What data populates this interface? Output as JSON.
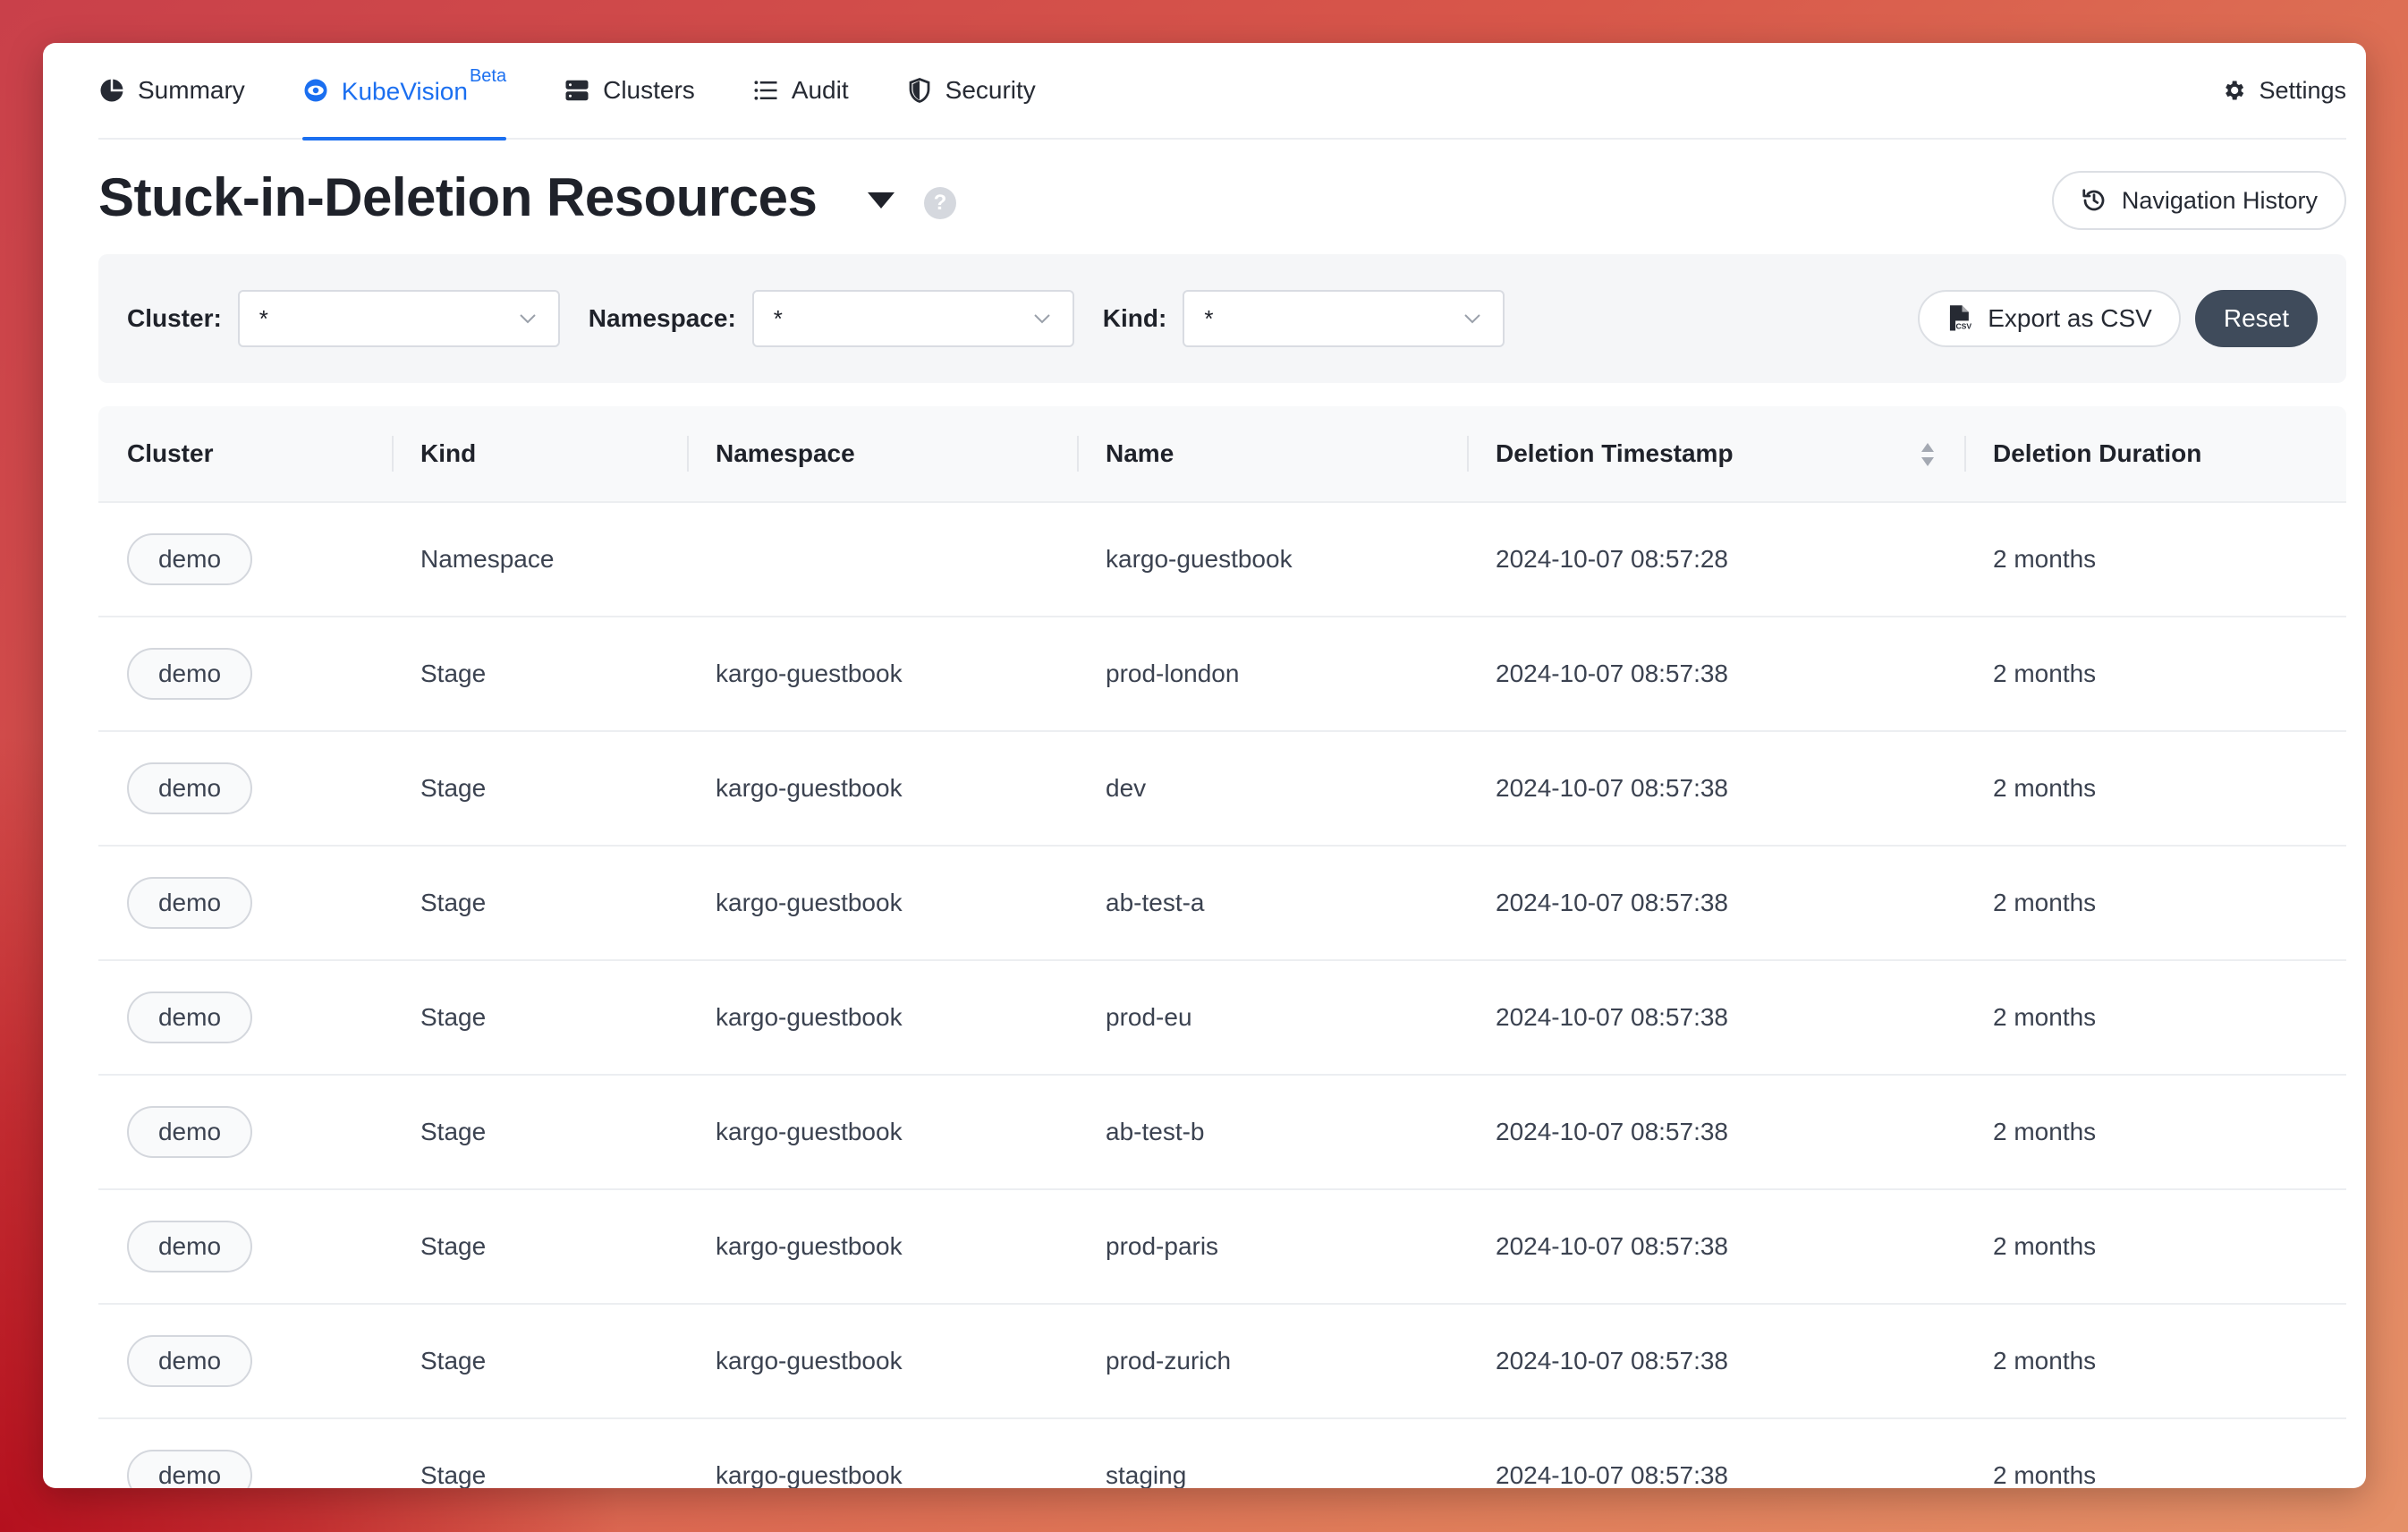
{
  "nav": {
    "tabs": [
      {
        "label": "Summary",
        "icon": "pie-chart-icon"
      },
      {
        "label": "KubeVision",
        "badge": "Beta",
        "icon": "eye-icon",
        "active": true
      },
      {
        "label": "Clusters",
        "icon": "server-icon"
      },
      {
        "label": "Audit",
        "icon": "list-icon"
      },
      {
        "label": "Security",
        "icon": "shield-icon"
      }
    ],
    "settings_label": "Settings",
    "accent_color": "#1b6ff0"
  },
  "header": {
    "title": "Stuck-in-Deletion Resources",
    "help": "?",
    "nav_history_label": "Navigation History"
  },
  "filters": {
    "cluster_label": "Cluster:",
    "cluster_value": "*",
    "namespace_label": "Namespace:",
    "namespace_value": "*",
    "kind_label": "Kind:",
    "kind_value": "*",
    "export_label": "Export as CSV",
    "reset_label": "Reset"
  },
  "table": {
    "columns": [
      "Cluster",
      "Kind",
      "Namespace",
      "Name",
      "Deletion Timestamp",
      "Deletion Duration"
    ],
    "rows": [
      {
        "cluster": "demo",
        "kind": "Namespace",
        "namespace": "",
        "name": "kargo-guestbook",
        "timestamp": "2024-10-07 08:57:28",
        "duration": "2 months"
      },
      {
        "cluster": "demo",
        "kind": "Stage",
        "namespace": "kargo-guestbook",
        "name": "prod-london",
        "timestamp": "2024-10-07 08:57:38",
        "duration": "2 months"
      },
      {
        "cluster": "demo",
        "kind": "Stage",
        "namespace": "kargo-guestbook",
        "name": "dev",
        "timestamp": "2024-10-07 08:57:38",
        "duration": "2 months"
      },
      {
        "cluster": "demo",
        "kind": "Stage",
        "namespace": "kargo-guestbook",
        "name": "ab-test-a",
        "timestamp": "2024-10-07 08:57:38",
        "duration": "2 months"
      },
      {
        "cluster": "demo",
        "kind": "Stage",
        "namespace": "kargo-guestbook",
        "name": "prod-eu",
        "timestamp": "2024-10-07 08:57:38",
        "duration": "2 months"
      },
      {
        "cluster": "demo",
        "kind": "Stage",
        "namespace": "kargo-guestbook",
        "name": "ab-test-b",
        "timestamp": "2024-10-07 08:57:38",
        "duration": "2 months"
      },
      {
        "cluster": "demo",
        "kind": "Stage",
        "namespace": "kargo-guestbook",
        "name": "prod-paris",
        "timestamp": "2024-10-07 08:57:38",
        "duration": "2 months"
      },
      {
        "cluster": "demo",
        "kind": "Stage",
        "namespace": "kargo-guestbook",
        "name": "prod-zurich",
        "timestamp": "2024-10-07 08:57:38",
        "duration": "2 months"
      },
      {
        "cluster": "demo",
        "kind": "Stage",
        "namespace": "kargo-guestbook",
        "name": "staging",
        "timestamp": "2024-10-07 08:57:38",
        "duration": "2 months"
      }
    ]
  }
}
